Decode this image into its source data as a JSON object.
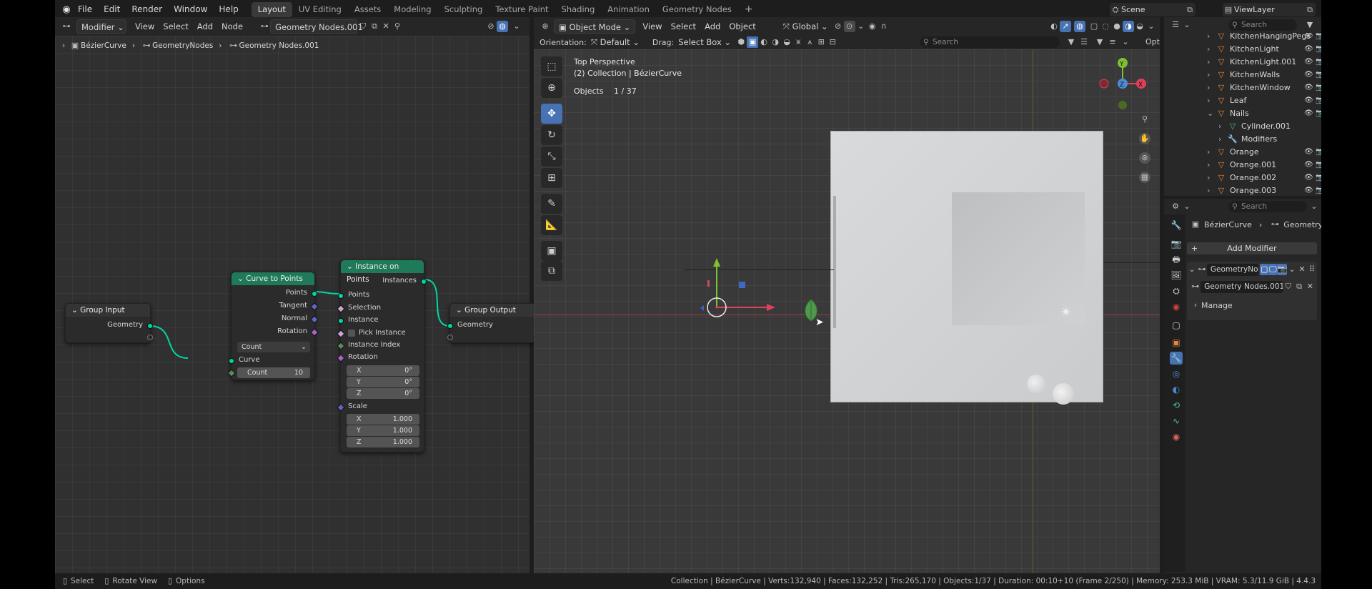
{
  "topbar": {
    "menus": [
      "File",
      "Edit",
      "Render",
      "Window",
      "Help"
    ],
    "workspaces": [
      "Layout",
      "UV Editing",
      "Assets",
      "Modeling",
      "Sculpting",
      "Texture Paint",
      "Shading",
      "Animation",
      "Geometry Nodes"
    ],
    "active_workspace": "Layout",
    "add_tab": "+",
    "scene_label": "Scene",
    "viewlayer_label": "ViewLayer"
  },
  "node_editor": {
    "header": {
      "context": "Modifier",
      "menus": [
        "View",
        "Select",
        "Add",
        "Node"
      ],
      "node_group": "Geometry Nodes.001"
    },
    "breadcrumb": [
      "BézierCurve",
      "GeometryNodes",
      "Geometry Nodes.001"
    ],
    "nodes": {
      "group_input": {
        "title": "Group Input",
        "out_geometry": "Geometry"
      },
      "curve_to_points": {
        "title": "Curve to Points",
        "outputs": [
          "Points",
          "Tangent",
          "Normal",
          "Rotation"
        ],
        "mode": "Count",
        "in_curve": "Curve",
        "count_label": "Count",
        "count_value": "10"
      },
      "instance_on_points": {
        "title": "Instance on Points",
        "out": "Instances",
        "inputs": [
          "Points",
          "Selection",
          "Instance"
        ],
        "pick_instance": "Pick Instance",
        "instance_index": "Instance Index",
        "rotation": "Rotation",
        "rot": [
          {
            "axis": "X",
            "value": "0°"
          },
          {
            "axis": "Y",
            "value": "0°"
          },
          {
            "axis": "Z",
            "value": "0°"
          }
        ],
        "scale": "Scale",
        "scl": [
          {
            "axis": "X",
            "value": "1.000"
          },
          {
            "axis": "Y",
            "value": "1.000"
          },
          {
            "axis": "Z",
            "value": "1.000"
          }
        ]
      },
      "group_output": {
        "title": "Group Output",
        "in_geometry": "Geometry"
      }
    },
    "status": {
      "select": "Select",
      "rotate": "Rotate View",
      "options": "Options"
    }
  },
  "viewport": {
    "header": {
      "mode": "Object Mode",
      "menus": [
        "View",
        "Select",
        "Add",
        "Object"
      ],
      "transform": "Global",
      "orientation_label": "Orientation:",
      "orientation": "Default",
      "drag_label": "Drag:",
      "drag": "Select Box",
      "search_placeholder": "Search",
      "options": "Opt"
    },
    "overlay": {
      "view_name": "Top Perspective",
      "collection": "(2) Collection | BézierCurve",
      "objects_label": "Objects",
      "objects_value": "1 / 37"
    },
    "gizmo_axes": {
      "x": "X",
      "y": "Y",
      "z": "Z"
    }
  },
  "outliner": {
    "search_placeholder": "Search",
    "items": [
      {
        "label": "KitchenHangingPegs",
        "icon": "object-icon"
      },
      {
        "label": "KitchenLight",
        "icon": "object-icon"
      },
      {
        "label": "KitchenLight.001",
        "icon": "object-icon"
      },
      {
        "label": "KitchenWalls",
        "icon": "object-icon"
      },
      {
        "label": "KitchenWindow",
        "icon": "object-icon"
      },
      {
        "label": "Leaf",
        "icon": "object-icon"
      },
      {
        "label": "Nails",
        "icon": "object-icon"
      },
      {
        "label": "Cylinder.001",
        "icon": "mesh-icon"
      },
      {
        "label": "Modifiers",
        "icon": "wrench-icon"
      },
      {
        "label": "Orange",
        "icon": "object-icon"
      },
      {
        "label": "Orange.001",
        "icon": "object-icon"
      },
      {
        "label": "Orange.002",
        "icon": "object-icon"
      },
      {
        "label": "Orange.003",
        "icon": "object-icon"
      }
    ]
  },
  "properties": {
    "search_placeholder": "Search",
    "breadcrumb": [
      "BézierCurve",
      "GeometryNodes"
    ],
    "add_modifier": "Add Modifier",
    "modifier_name": "GeometryNodes",
    "node_group": "Geometry Nodes.001",
    "manage": "Manage"
  },
  "statusbar": {
    "text": "Collection | BézierCurve | Verts:132,940 | Faces:132,252 | Tris:265,170 | Objects:1/37 | Duration: 00:10+10 (Frame 2/250) | Memory: 253.3 MiB | VRAM: 5.3/11.9 GiB | 4.4.3"
  },
  "colors": {
    "accent": "#4772b3",
    "node_geometry_header": "#1f7a5a",
    "socket_geometry": "#00d6a3",
    "socket_vector": "#6363c7",
    "socket_rotation": "#a663c7",
    "socket_int": "#598c5c",
    "socket_bool": "#cca6d6"
  }
}
